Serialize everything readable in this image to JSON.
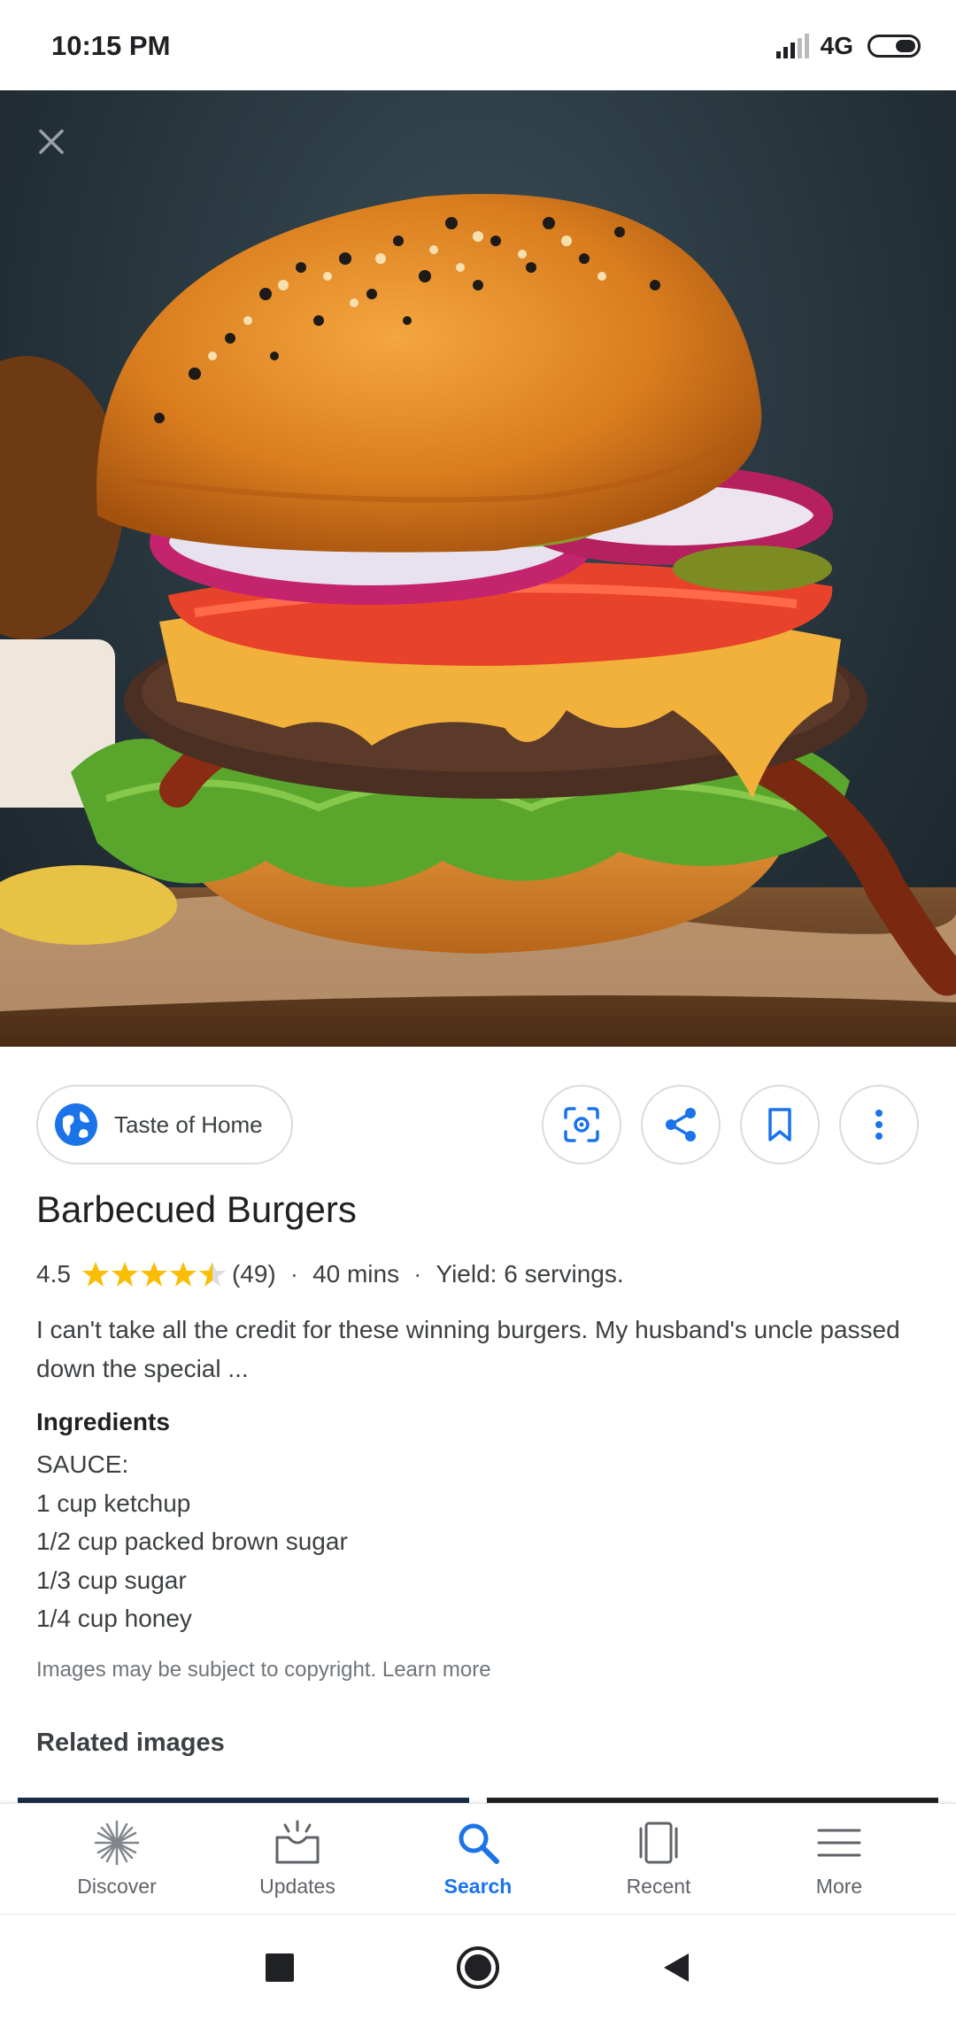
{
  "status_bar": {
    "time": "10:15 PM",
    "network": "4G"
  },
  "source": {
    "name": "Taste of Home"
  },
  "recipe": {
    "title": "Barbecued Burgers",
    "rating": "4.5",
    "rating_value": 4.5,
    "review_count": "(49)",
    "time": "40 mins",
    "yield": "Yield: 6 servings.",
    "description": "I can't take all the credit for these winning burgers. My husband's uncle passed down the special ...",
    "ingredients_heading": "Ingredients",
    "ingredients": [
      "SAUCE:",
      "1 cup ketchup",
      "1/2 cup packed brown sugar",
      "1/3 cup sugar",
      "1/4 cup honey"
    ]
  },
  "copyright_text": "Images may be subject to copyright. Learn more",
  "related_heading": "Related images",
  "bottom_nav": [
    {
      "label": "Discover",
      "icon": "asterisk-icon"
    },
    {
      "label": "Updates",
      "icon": "updates-tray-icon"
    },
    {
      "label": "Search",
      "icon": "search-icon",
      "active": true
    },
    {
      "label": "Recent",
      "icon": "recent-cards-icon"
    },
    {
      "label": "More",
      "icon": "menu-icon"
    }
  ],
  "colors": {
    "accent": "#1a73e8",
    "star": "#fbbc04",
    "text": "#202124"
  }
}
